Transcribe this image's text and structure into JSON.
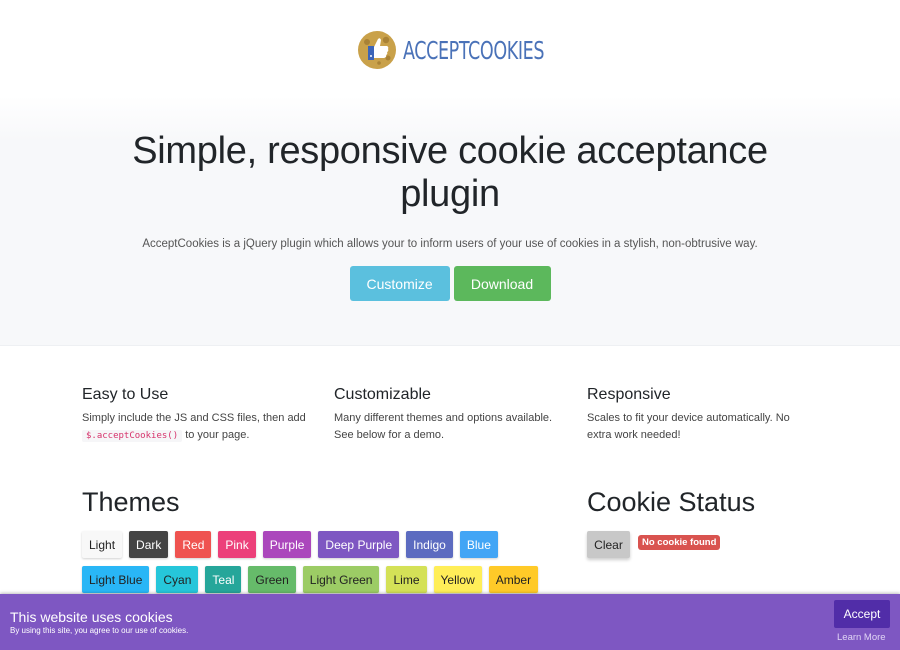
{
  "logo": {
    "text": "ACCEPTCOOKIES",
    "icon": "cookie-thumbs-up-icon"
  },
  "hero": {
    "title": "Simple, responsive cookie acceptance plugin",
    "lead": "AcceptCookies is a jQuery plugin which allows your to inform users of your use of cookies in a stylish, non-obtrusive way.",
    "customize_label": "Customize",
    "download_label": "Download"
  },
  "features": [
    {
      "title": "Easy to Use",
      "text_before": "Simply include the JS and CSS files, then add",
      "code": "$.acceptCookies()",
      "text_after": "to your page."
    },
    {
      "title": "Customizable",
      "text": "Many different themes and options available. See below for a demo."
    },
    {
      "title": "Responsive",
      "text": "Scales to fit your device automatically. No extra work needed!"
    }
  ],
  "themes": {
    "title": "Themes",
    "items": [
      {
        "label": "Light",
        "bg": "#f8f8f8",
        "fg": "#222222"
      },
      {
        "label": "Dark",
        "bg": "#444444",
        "fg": "#ffffff"
      },
      {
        "label": "Red",
        "bg": "#ef5350",
        "fg": "#ffffff"
      },
      {
        "label": "Pink",
        "bg": "#ec407a",
        "fg": "#ffffff"
      },
      {
        "label": "Purple",
        "bg": "#ab47bc",
        "fg": "#ffffff"
      },
      {
        "label": "Deep Purple",
        "bg": "#7e57c2",
        "fg": "#ffffff"
      },
      {
        "label": "Indigo",
        "bg": "#5c6bc0",
        "fg": "#ffffff"
      },
      {
        "label": "Blue",
        "bg": "#42a5f5",
        "fg": "#ffffff"
      },
      {
        "label": "Light Blue",
        "bg": "#29b6f6",
        "fg": "#222222"
      },
      {
        "label": "Cyan",
        "bg": "#26c6da",
        "fg": "#222222"
      },
      {
        "label": "Teal",
        "bg": "#26a69a",
        "fg": "#ffffff"
      },
      {
        "label": "Green",
        "bg": "#66bb6a",
        "fg": "#222222"
      },
      {
        "label": "Light Green",
        "bg": "#9ccc65",
        "fg": "#222222"
      },
      {
        "label": "Lime",
        "bg": "#d4e157",
        "fg": "#222222"
      },
      {
        "label": "Yellow",
        "bg": "#ffee58",
        "fg": "#222222"
      },
      {
        "label": "Amber",
        "bg": "#ffca28",
        "fg": "#222222"
      }
    ]
  },
  "cookie_status": {
    "title": "Cookie Status",
    "clear_label": "Clear",
    "status_text": "No cookie found"
  },
  "cookie_bar": {
    "title": "This website uses cookies",
    "subtitle": "By using this site, you agree to our use of cookies.",
    "accept_label": "Accept",
    "learn_more_label": "Learn More"
  }
}
